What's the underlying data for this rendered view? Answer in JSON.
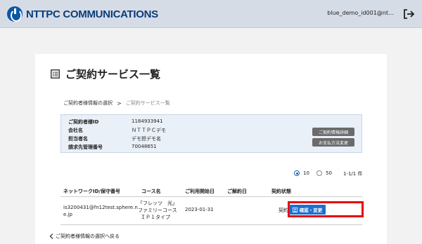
{
  "header": {
    "logo_text": "NTTPC COMMUNICATIONS",
    "user_name": "blue_demo_id001@nt…",
    "logout_icon": "logout-icon"
  },
  "page": {
    "title": "ご契約サービス一覧",
    "title_icon": "list-icon"
  },
  "breadcrumb": {
    "item1": "ご契約者様情報の選択",
    "separator": ">",
    "item2": "ご契約サービス一覧"
  },
  "contract_info": {
    "rows": [
      {
        "label": "ご契約者様ID",
        "value": "1184933941"
      },
      {
        "label": "会社名",
        "value": "ＮＴＴＰＣデモ"
      },
      {
        "label": "担当者名",
        "value": "デモ担デモ名"
      },
      {
        "label": "請求先管理番号",
        "value": "70048651"
      }
    ],
    "detail_button": "ご契約情報詳細",
    "payment_button": "お支払方法変更"
  },
  "pager": {
    "option1": "10",
    "option2": "50",
    "selected": "10",
    "count": "1-1/1 件"
  },
  "table": {
    "headers": [
      "ネットワークID/保守番号",
      "コース名",
      "ご利用開始日",
      "ご解約日",
      "契約状態"
    ],
    "rows": [
      {
        "network_id_line1": "is3200431@fn12test.sphere.n",
        "network_id_line2": "e.jp",
        "course_line1": "「フレッツ　光」",
        "course_line2": "ファミリーコース",
        "course_line3": "ＩＰ１タイプ",
        "start_date": "2023-01-31",
        "cancel_date": "",
        "status": "契約中",
        "action_label": "確認・変更"
      }
    ]
  },
  "back_link": "ご契約者様情報の選択へ戻る",
  "colors": {
    "header_bg": "#d6dce6",
    "brand_blue": "#0a57a6",
    "action_blue": "#1f6fcf",
    "highlight_red": "#e60012",
    "info_bg": "#eaf0f8"
  }
}
